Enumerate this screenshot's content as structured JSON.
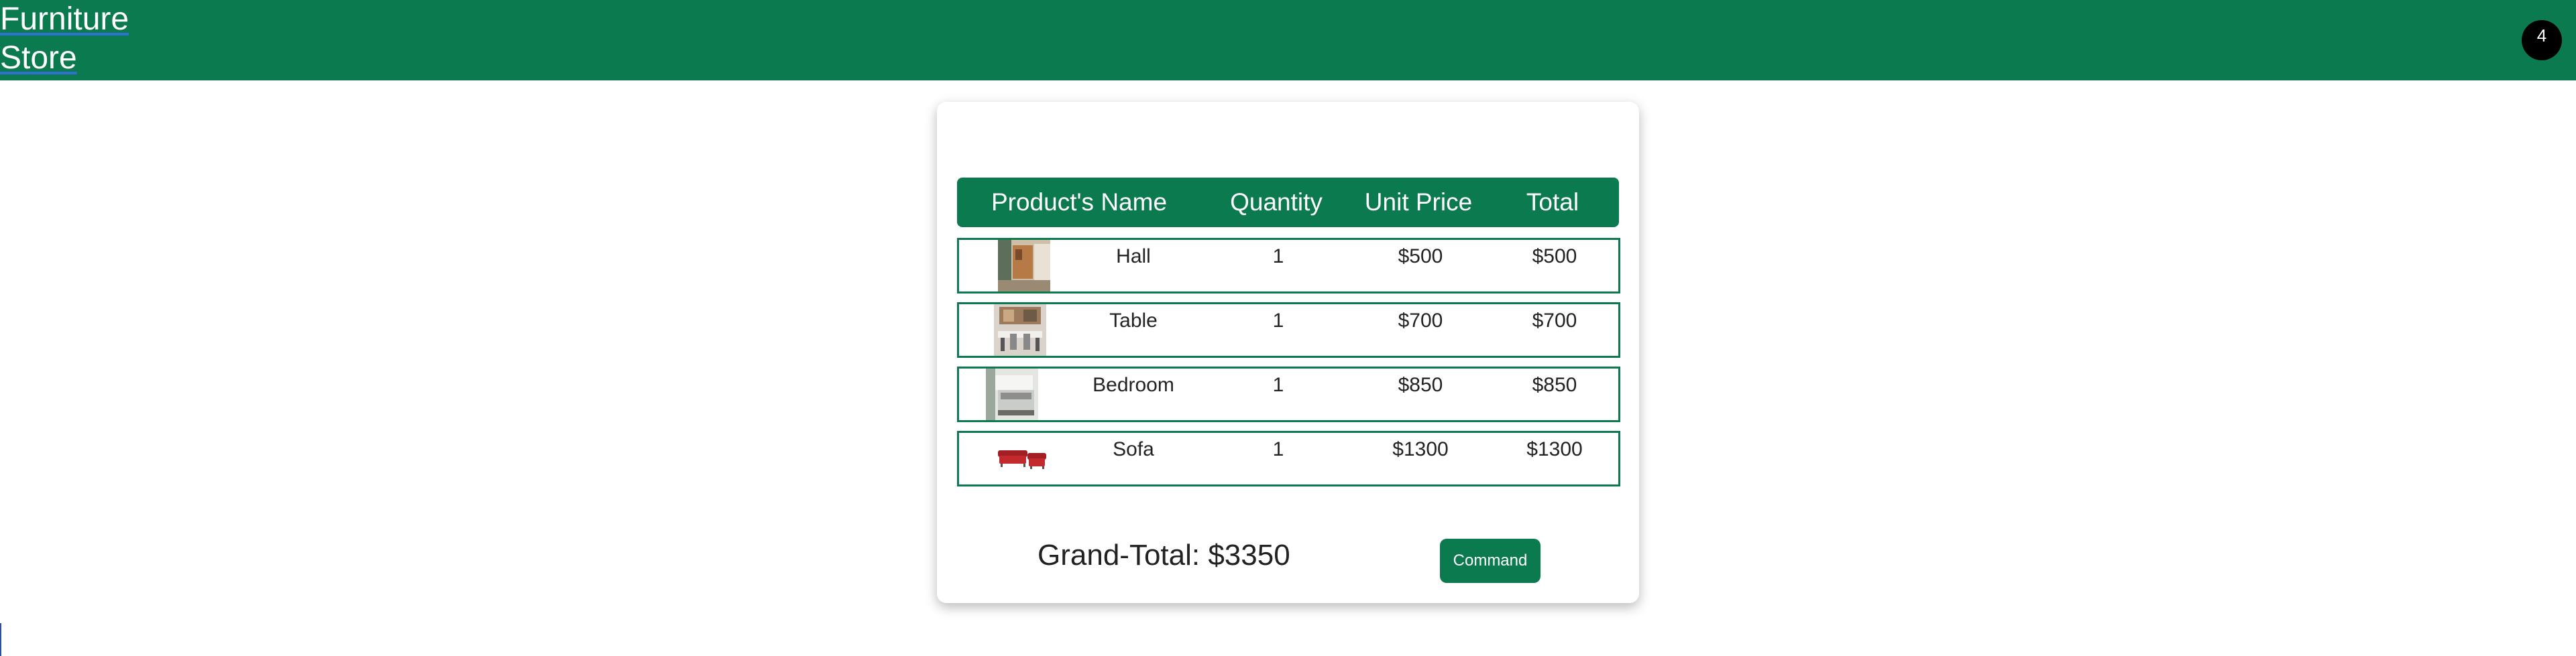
{
  "navbar": {
    "brand_line1": "Furniture",
    "brand_line2": "Store",
    "cart_count": "4",
    "bg_color": "#0b7a4f"
  },
  "table": {
    "headers": {
      "name": "Product's Name",
      "quantity": "Quantity",
      "unit_price": "Unit Price",
      "total": "Total"
    },
    "rows": [
      {
        "name": "Hall",
        "quantity": "1",
        "unit_price": "$500",
        "total": "$500",
        "image": "hall-thumbnail"
      },
      {
        "name": "Table",
        "quantity": "1",
        "unit_price": "$700",
        "total": "$700",
        "image": "dining-table-thumbnail"
      },
      {
        "name": "Bedroom",
        "quantity": "1",
        "unit_price": "$850",
        "total": "$850",
        "image": "bedroom-thumbnail"
      },
      {
        "name": "Sofa",
        "quantity": "1",
        "unit_price": "$1300",
        "total": "$1300",
        "image": "red-sofa-thumbnail"
      }
    ]
  },
  "summary": {
    "grand_total": "Grand-Total: $3350",
    "command_label": "Command"
  }
}
